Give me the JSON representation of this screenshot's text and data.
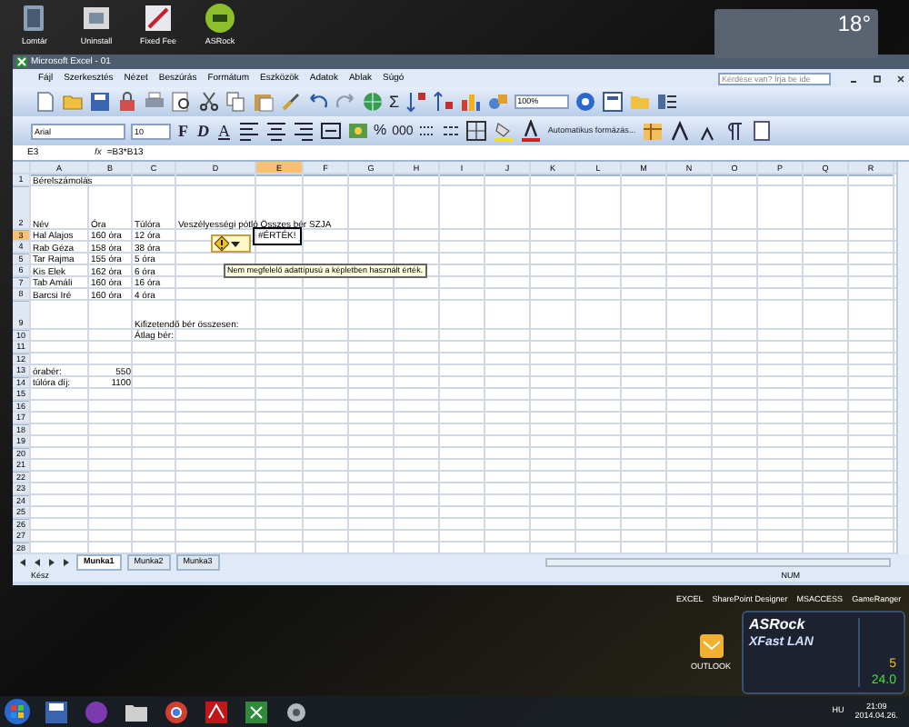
{
  "desktop_icons": [
    {
      "label": "Lomtár"
    },
    {
      "label": "Uninstall"
    },
    {
      "label": "Fixed Fee"
    },
    {
      "label": "ASRock"
    }
  ],
  "weather": {
    "temperature": "18°"
  },
  "window": {
    "title": "Microsoft Excel - 01"
  },
  "menu": [
    "Fájl",
    "Szerkesztés",
    "Nézet",
    "Beszúrás",
    "Formátum",
    "Eszközök",
    "Adatok",
    "Ablak",
    "Súgó"
  ],
  "help_box": {
    "placeholder": "Kérdése van? Írja be ide"
  },
  "toolbar": {
    "sum": "Σ",
    "zoom": "100%"
  },
  "format_bar": {
    "font": "Arial",
    "size": "10",
    "style_buttons": [
      "F",
      "D",
      "A"
    ],
    "percent": "%",
    "thousands": "000",
    "autoformat": "Automatikus formázás..."
  },
  "formula_bar": {
    "name_box": "E3",
    "fx": "fx",
    "formula": "=B3*B13"
  },
  "sheet": {
    "columns": [
      {
        "label": "A",
        "selected": false
      },
      {
        "label": "B",
        "selected": false
      },
      {
        "label": "C",
        "selected": false
      },
      {
        "label": "D",
        "selected": false
      },
      {
        "label": "E",
        "selected": true
      },
      {
        "label": "F",
        "selected": false
      },
      {
        "label": "G",
        "selected": false
      },
      {
        "label": "H",
        "selected": false
      },
      {
        "label": "I",
        "selected": false
      },
      {
        "label": "J",
        "selected": false
      },
      {
        "label": "K",
        "selected": false
      },
      {
        "label": "L",
        "selected": false
      },
      {
        "label": "M",
        "selected": false
      },
      {
        "label": "N",
        "selected": false
      },
      {
        "label": "O",
        "selected": false
      },
      {
        "label": "P",
        "selected": false
      },
      {
        "label": "Q",
        "selected": false
      },
      {
        "label": "R",
        "selected": false
      }
    ],
    "rows": [
      {
        "number": "1",
        "selected": false,
        "cells": [
          {
            "text": "Bérelszámolás",
            "kind": "text",
            "selected": false
          }
        ]
      },
      {
        "number": "2",
        "selected": false,
        "cells": [
          {
            "text": "Név",
            "kind": "text",
            "selected": false
          },
          {
            "text": "Óra",
            "kind": "text",
            "selected": false
          },
          {
            "text": "Túlóra",
            "kind": "text",
            "selected": false
          },
          {
            "text": "Veszélyességi pótló Összes bér SZJA",
            "kind": "text",
            "selected": false
          }
        ]
      },
      {
        "number": "3",
        "selected": true,
        "cells": [
          {
            "text": "Hal Alajos",
            "kind": "text",
            "selected": false
          },
          {
            "text": "160 óra",
            "kind": "text",
            "selected": false
          },
          {
            "text": "12 óra",
            "kind": "text",
            "selected": false
          },
          null,
          {
            "text": "#ÉRTÉK!",
            "kind": "text",
            "selected": true
          }
        ]
      },
      {
        "number": "4",
        "selected": false,
        "cells": [
          {
            "text": "Rab Géza",
            "kind": "text",
            "selected": false
          },
          {
            "text": "158 óra",
            "kind": "text",
            "selected": false
          },
          {
            "text": "38 óra",
            "kind": "text",
            "selected": false
          }
        ]
      },
      {
        "number": "5",
        "selected": false,
        "cells": [
          {
            "text": "Tar Rajma",
            "kind": "text",
            "selected": false
          },
          {
            "text": "155 óra",
            "kind": "text",
            "selected": false
          },
          {
            "text": "5 óra",
            "kind": "text",
            "selected": false
          }
        ]
      },
      {
        "number": "6",
        "selected": false,
        "cells": [
          {
            "text": "Kis Elek",
            "kind": "text",
            "selected": false
          },
          {
            "text": "162 óra",
            "kind": "text",
            "selected": false
          },
          {
            "text": "6 óra",
            "kind": "text",
            "selected": false
          }
        ]
      },
      {
        "number": "7",
        "selected": false,
        "cells": [
          {
            "text": "Tab Amáli",
            "kind": "text",
            "selected": false
          },
          {
            "text": "160 óra",
            "kind": "text",
            "selected": false
          },
          {
            "text": "16 óra",
            "kind": "text",
            "selected": false
          }
        ]
      },
      {
        "number": "8",
        "selected": false,
        "cells": [
          {
            "text": "Barcsi Iré",
            "kind": "text",
            "selected": false
          },
          {
            "text": "160 óra",
            "kind": "text",
            "selected": false
          },
          {
            "text": "4 óra",
            "kind": "text",
            "selected": false
          }
        ]
      },
      {
        "number": "9",
        "selected": false,
        "cells": [
          null,
          null,
          {
            "text": "Kifizetendő bér összesen:",
            "kind": "text",
            "selected": false
          }
        ]
      },
      {
        "number": "10",
        "selected": false,
        "cells": [
          null,
          null,
          {
            "text": "Átlag bér:",
            "kind": "text",
            "selected": false
          }
        ]
      },
      {
        "number": "11",
        "selected": false,
        "cells": []
      },
      {
        "number": "12",
        "selected": false,
        "cells": []
      },
      {
        "number": "13",
        "selected": false,
        "cells": [
          {
            "text": "órabér:",
            "kind": "text",
            "selected": false
          },
          {
            "text": "550",
            "kind": "number",
            "selected": false
          }
        ]
      },
      {
        "number": "14",
        "selected": false,
        "cells": [
          {
            "text": "túlóra díj:",
            "kind": "text",
            "selected": false
          },
          {
            "text": "1100",
            "kind": "number",
            "selected": false
          }
        ]
      },
      {
        "number": "15",
        "selected": false,
        "cells": []
      },
      {
        "number": "16",
        "selected": false,
        "cells": []
      },
      {
        "number": "17",
        "selected": false,
        "cells": []
      },
      {
        "number": "18",
        "selected": false,
        "cells": []
      },
      {
        "number": "19",
        "selected": false,
        "cells": []
      },
      {
        "number": "20",
        "selected": false,
        "cells": []
      },
      {
        "number": "21",
        "selected": false,
        "cells": []
      },
      {
        "number": "22",
        "selected": false,
        "cells": []
      },
      {
        "number": "23",
        "selected": false,
        "cells": []
      },
      {
        "number": "24",
        "selected": false,
        "cells": []
      },
      {
        "number": "25",
        "selected": false,
        "cells": []
      },
      {
        "number": "26",
        "selected": false,
        "cells": []
      },
      {
        "number": "27",
        "selected": false,
        "cells": []
      },
      {
        "number": "28",
        "selected": false,
        "cells": []
      }
    ],
    "error_tooltip": "Nem megfelelő adattípusú a képletben használt érték."
  },
  "sheet_tabs": [
    {
      "label": "Munka1",
      "selected": true
    },
    {
      "label": "Munka2",
      "selected": false
    },
    {
      "label": "Munka3",
      "selected": false
    }
  ],
  "status_bar": {
    "status": "Kész",
    "num_lock": "NUM"
  },
  "desktop_shortcuts": [
    "EXCEL",
    "SharePoint Designer",
    "MSACCESS",
    "GameRanger"
  ],
  "outlook_icon": {
    "label": "OUTLOOK"
  },
  "lan_widget": {
    "brand": "ASRock",
    "product": "XFast LAN",
    "readings": [
      "5",
      "24.0"
    ]
  },
  "taskbar": {
    "language": "HU",
    "time": "21:09",
    "date": "2014.04.26."
  }
}
